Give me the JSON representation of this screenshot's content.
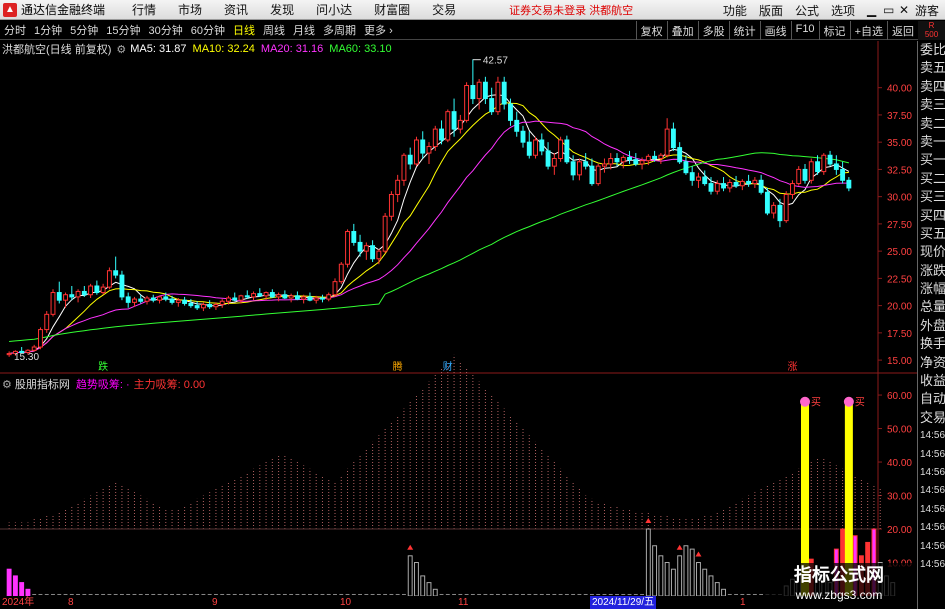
{
  "app": {
    "title": "通达信金融终端",
    "menus": [
      "行情",
      "市场",
      "资讯",
      "发现",
      "问小达",
      "财富圈",
      "交易"
    ],
    "notice": "证券交易未登录  洪都航空",
    "right_menus": [
      "功能",
      "版面",
      "公式",
      "选项"
    ],
    "window_buttons": [
      "▁",
      "▭",
      "✕"
    ],
    "guest": "游客"
  },
  "period_bar": {
    "tabs": [
      "分时",
      "1分钟",
      "5分钟",
      "15分钟",
      "30分钟",
      "60分钟",
      "日线",
      "周线",
      "月线",
      "多周期",
      "更多"
    ],
    "active": "日线",
    "more_arrow": "›",
    "tools": [
      "复权",
      "叠加",
      "多股",
      "统计",
      "画线",
      "F10",
      "标记",
      "+自选",
      "返回"
    ],
    "corner_tag": "R\n500"
  },
  "info": {
    "stock": "洪都航空(日线 前复权)",
    "ma": [
      {
        "label": "MA5: 31.87",
        "color": "#ffffff"
      },
      {
        "label": "MA10: 32.24",
        "color": "#ffff00"
      },
      {
        "label": "MA20: 31.16",
        "color": "#ff33ff"
      },
      {
        "label": "MA60: 33.10",
        "color": "#33ff33"
      }
    ]
  },
  "indicator": {
    "name": "股朋指标网",
    "line1": "趋势吸筹: ·",
    "line2": "主力吸筹: 0.00",
    "buy_label": "买"
  },
  "right_panel": [
    "委比",
    "卖五",
    "卖四",
    "卖三",
    "卖二",
    "卖一",
    "买一",
    "买二",
    "买三",
    "买四",
    "买五",
    "现价",
    "涨跌",
    "涨幅",
    "总量",
    "外盘",
    "换手",
    "净资",
    "收益",
    "自动",
    "交易",
    "14:56",
    "14:56",
    "14:56",
    "14:56",
    "14:56",
    "14:56",
    "14:56",
    "14:56"
  ],
  "price_axis": {
    "ticks": [
      "40.00",
      "37.50",
      "35.00",
      "32.50",
      "30.00",
      "27.50",
      "25.00",
      "22.50",
      "20.00",
      "17.50",
      "15.00"
    ]
  },
  "indicator_axis": {
    "ticks": [
      "60.00",
      "50.00",
      "40.00",
      "30.00",
      "20.00",
      "10.00"
    ]
  },
  "annotations": {
    "high": "42.57",
    "low": "15.30",
    "markers": [
      "跌",
      "腾",
      "财",
      "涨"
    ]
  },
  "date_axis": {
    "labels": [
      "2024年",
      "8",
      "9",
      "10",
      "11",
      "1"
    ],
    "cursor": "2024/11/29/五"
  },
  "watermark": {
    "line1": "指标公式网",
    "line2": "www.zbgs3.com"
  },
  "colors": {
    "up": "#ff3333",
    "down": "#33ffff",
    "ma5": "#ffffff",
    "ma10": "#ffff00",
    "ma20": "#ff33ff",
    "ma60": "#33ff33",
    "grid": "#8b1a1a"
  },
  "chart_data": {
    "type": "candlestick",
    "ylim": [
      14,
      43
    ],
    "indicator_ylim": [
      0,
      63
    ],
    "candles": [
      [
        15.5,
        15.8,
        15.3,
        15.6
      ],
      [
        15.6,
        15.9,
        15.4,
        15.8
      ],
      [
        15.8,
        16.2,
        15.6,
        15.7
      ],
      [
        15.7,
        16.0,
        15.5,
        15.9
      ],
      [
        15.9,
        16.4,
        15.8,
        16.2
      ],
      [
        16.2,
        18.0,
        16.0,
        17.8
      ],
      [
        17.8,
        19.5,
        17.5,
        19.2
      ],
      [
        19.2,
        21.5,
        19.0,
        21.2
      ],
      [
        21.2,
        22.2,
        20.2,
        20.5
      ],
      [
        20.5,
        21.2,
        19.8,
        21.0
      ],
      [
        21.0,
        21.8,
        20.5,
        20.8
      ],
      [
        20.8,
        21.5,
        20.3,
        21.3
      ],
      [
        21.3,
        21.8,
        20.8,
        21.0
      ],
      [
        21.0,
        22.0,
        20.7,
        21.8
      ],
      [
        21.8,
        22.3,
        21.0,
        21.2
      ],
      [
        21.2,
        22.0,
        21.0,
        21.7
      ],
      [
        21.7,
        23.5,
        21.5,
        23.2
      ],
      [
        23.2,
        24.5,
        22.5,
        22.8
      ],
      [
        22.8,
        23.2,
        20.5,
        20.8
      ],
      [
        20.8,
        21.2,
        19.8,
        20.3
      ],
      [
        20.3,
        20.8,
        19.9,
        20.6
      ],
      [
        20.6,
        21.0,
        20.2,
        20.4
      ],
      [
        20.4,
        20.9,
        20.1,
        20.7
      ],
      [
        20.7,
        21.0,
        20.3,
        20.5
      ],
      [
        20.5,
        20.9,
        20.2,
        20.8
      ],
      [
        20.8,
        21.2,
        20.4,
        20.6
      ],
      [
        20.6,
        20.9,
        20.1,
        20.3
      ],
      [
        20.3,
        20.7,
        19.9,
        20.5
      ],
      [
        20.5,
        20.8,
        20.0,
        20.2
      ],
      [
        20.2,
        20.6,
        19.8,
        20.0
      ],
      [
        20.0,
        20.4,
        19.6,
        19.8
      ],
      [
        19.8,
        20.3,
        19.5,
        20.1
      ],
      [
        20.1,
        20.5,
        19.7,
        19.9
      ],
      [
        19.9,
        20.3,
        19.6,
        20.1
      ],
      [
        20.1,
        20.6,
        19.8,
        20.4
      ],
      [
        20.4,
        20.9,
        20.1,
        20.7
      ],
      [
        20.7,
        21.2,
        20.4,
        20.5
      ],
      [
        20.5,
        21.0,
        20.2,
        20.9
      ],
      [
        20.9,
        21.4,
        20.6,
        20.8
      ],
      [
        20.8,
        21.3,
        20.5,
        21.1
      ],
      [
        21.1,
        21.6,
        20.8,
        20.9
      ],
      [
        20.9,
        21.3,
        20.5,
        21.2
      ],
      [
        21.2,
        21.5,
        20.7,
        20.8
      ],
      [
        20.8,
        21.2,
        20.4,
        21.0
      ],
      [
        21.0,
        21.4,
        20.6,
        20.7
      ],
      [
        20.7,
        21.1,
        20.3,
        20.9
      ],
      [
        20.9,
        21.3,
        20.5,
        20.6
      ],
      [
        20.6,
        21.0,
        20.2,
        20.8
      ],
      [
        20.8,
        21.2,
        20.4,
        20.5
      ],
      [
        20.5,
        20.9,
        20.2,
        20.7
      ],
      [
        20.7,
        21.0,
        20.3,
        20.6
      ],
      [
        20.6,
        21.2,
        20.4,
        21.0
      ],
      [
        21.0,
        22.5,
        20.8,
        22.2
      ],
      [
        22.2,
        24.0,
        22.0,
        23.8
      ],
      [
        23.8,
        27.0,
        23.5,
        26.8
      ],
      [
        26.8,
        27.5,
        25.5,
        25.8
      ],
      [
        25.8,
        26.5,
        24.5,
        25.0
      ],
      [
        25.0,
        25.8,
        24.2,
        25.5
      ],
      [
        25.5,
        26.0,
        24.0,
        24.3
      ],
      [
        24.3,
        25.2,
        23.8,
        25.0
      ],
      [
        25.0,
        28.5,
        24.8,
        28.2
      ],
      [
        28.2,
        30.5,
        27.8,
        30.2
      ],
      [
        30.2,
        32.0,
        29.5,
        31.5
      ],
      [
        31.5,
        34.0,
        31.0,
        33.8
      ],
      [
        33.8,
        34.5,
        32.5,
        33.0
      ],
      [
        33.0,
        35.5,
        32.8,
        35.2
      ],
      [
        35.2,
        36.0,
        33.5,
        34.0
      ],
      [
        34.0,
        35.0,
        33.0,
        34.6
      ],
      [
        34.6,
        36.5,
        34.2,
        36.2
      ],
      [
        36.2,
        37.0,
        34.8,
        35.2
      ],
      [
        35.2,
        38.0,
        35.0,
        37.8
      ],
      [
        37.8,
        39.0,
        35.5,
        36.2
      ],
      [
        36.2,
        37.5,
        35.8,
        37.0
      ],
      [
        37.0,
        40.5,
        36.8,
        40.2
      ],
      [
        40.2,
        42.6,
        38.5,
        39.0
      ],
      [
        39.0,
        40.8,
        38.0,
        40.5
      ],
      [
        40.5,
        41.0,
        38.5,
        39.0
      ],
      [
        39.0,
        40.0,
        37.5,
        37.8
      ],
      [
        37.8,
        41.0,
        37.5,
        40.5
      ],
      [
        40.5,
        41.0,
        38.0,
        38.5
      ],
      [
        38.5,
        39.0,
        36.5,
        37.0
      ],
      [
        37.0,
        37.8,
        35.5,
        36.0
      ],
      [
        36.0,
        36.5,
        34.5,
        35.0
      ],
      [
        35.0,
        36.0,
        33.5,
        33.8
      ],
      [
        33.8,
        35.5,
        33.5,
        35.2
      ],
      [
        35.2,
        35.8,
        33.8,
        34.2
      ],
      [
        34.2,
        35.0,
        32.5,
        32.8
      ],
      [
        32.8,
        34.0,
        32.0,
        33.5
      ],
      [
        33.5,
        35.5,
        33.2,
        35.2
      ],
      [
        35.2,
        35.6,
        33.0,
        33.2
      ],
      [
        33.2,
        33.8,
        31.5,
        32.0
      ],
      [
        32.0,
        33.5,
        31.5,
        33.2
      ],
      [
        33.2,
        34.0,
        32.5,
        32.8
      ],
      [
        32.8,
        33.5,
        31.0,
        31.2
      ],
      [
        31.2,
        33.0,
        31.0,
        32.8
      ],
      [
        32.8,
        33.5,
        32.2,
        33.0
      ],
      [
        33.0,
        34.0,
        32.5,
        33.5
      ],
      [
        33.5,
        34.0,
        32.8,
        33.2
      ],
      [
        33.2,
        33.8,
        32.6,
        33.6
      ],
      [
        33.6,
        34.2,
        33.0,
        33.4
      ],
      [
        33.4,
        34.0,
        32.8,
        33.0
      ],
      [
        33.0,
        33.6,
        32.5,
        33.3
      ],
      [
        33.3,
        33.9,
        32.9,
        33.7
      ],
      [
        33.7,
        34.2,
        33.2,
        33.5
      ],
      [
        33.5,
        34.0,
        33.0,
        33.8
      ],
      [
        33.8,
        37.2,
        33.6,
        36.2
      ],
      [
        36.2,
        36.8,
        34.2,
        34.5
      ],
      [
        34.5,
        35.0,
        33.0,
        33.2
      ],
      [
        33.2,
        33.8,
        32.0,
        32.2
      ],
      [
        32.2,
        32.8,
        31.0,
        31.5
      ],
      [
        31.5,
        32.2,
        30.8,
        31.8
      ],
      [
        31.8,
        32.4,
        31.0,
        31.2
      ],
      [
        31.2,
        31.8,
        30.2,
        30.5
      ],
      [
        30.5,
        31.5,
        30.2,
        31.2
      ],
      [
        31.2,
        31.8,
        30.5,
        30.8
      ],
      [
        30.8,
        31.6,
        30.4,
        31.3
      ],
      [
        31.3,
        31.9,
        30.8,
        31.0
      ],
      [
        31.0,
        31.6,
        30.6,
        31.4
      ],
      [
        31.4,
        32.0,
        30.9,
        31.2
      ],
      [
        31.2,
        31.8,
        30.8,
        31.5
      ],
      [
        31.5,
        32.0,
        30.2,
        30.4
      ],
      [
        30.4,
        30.8,
        28.3,
        28.5
      ],
      [
        28.5,
        29.5,
        28.0,
        29.2
      ],
      [
        29.2,
        29.8,
        27.2,
        27.8
      ],
      [
        27.8,
        30.5,
        27.6,
        30.2
      ],
      [
        30.2,
        31.5,
        29.8,
        31.2
      ],
      [
        31.2,
        32.8,
        31.0,
        32.5
      ],
      [
        32.5,
        33.0,
        31.2,
        31.5
      ],
      [
        31.5,
        33.5,
        31.2,
        33.2
      ],
      [
        33.2,
        33.8,
        32.0,
        32.3
      ],
      [
        32.3,
        34.0,
        32.0,
        33.8
      ],
      [
        33.8,
        34.2,
        32.8,
        33.0
      ],
      [
        33.0,
        33.8,
        32.0,
        32.5
      ],
      [
        32.5,
        33.2,
        31.2,
        31.5
      ],
      [
        31.5,
        31.8,
        30.5,
        30.8
      ]
    ],
    "volumes_bg": [
      2,
      2,
      2,
      2,
      3,
      3,
      4,
      4,
      5,
      6,
      7,
      8,
      9,
      10,
      11,
      12,
      13,
      14,
      13,
      12,
      11,
      10,
      9,
      8,
      7,
      6,
      6,
      6,
      7,
      8,
      9,
      10,
      11,
      12,
      13,
      14,
      15,
      16,
      17,
      18,
      19,
      20,
      21,
      22,
      22,
      21,
      20,
      19,
      18,
      17,
      16,
      15,
      14,
      16,
      18,
      20,
      22,
      24,
      26,
      28,
      30,
      32,
      34,
      36,
      38,
      40,
      42,
      44,
      46,
      48,
      50,
      52,
      50,
      48,
      46,
      44,
      42,
      40,
      38,
      36,
      34,
      32,
      30,
      28,
      26,
      24,
      22,
      20,
      18,
      16,
      14,
      12,
      10,
      9,
      8,
      8,
      7,
      7,
      6,
      6,
      5,
      5,
      5,
      4,
      4,
      4,
      3,
      3,
      3,
      3,
      3,
      4,
      4,
      5,
      6,
      7,
      8,
      9,
      10,
      11,
      12,
      13,
      14,
      15,
      16,
      17,
      18,
      19,
      20,
      21,
      21,
      20,
      19,
      18,
      17,
      16,
      15,
      14,
      13,
      12
    ],
    "volumes_fg": [
      8,
      6,
      4,
      2,
      1,
      1,
      1,
      1,
      1,
      1,
      1,
      1,
      1,
      1,
      1,
      1,
      1,
      1,
      1,
      1,
      1,
      1,
      1,
      1,
      1,
      1,
      1,
      1,
      1,
      1,
      1,
      1,
      1,
      1,
      1,
      1,
      1,
      1,
      1,
      1,
      1,
      1,
      1,
      1,
      1,
      1,
      1,
      1,
      1,
      1,
      1,
      1,
      1,
      1,
      1,
      1,
      1,
      1,
      1,
      1,
      1,
      1,
      1,
      1,
      12,
      10,
      6,
      4,
      2,
      1,
      1,
      1,
      1,
      1,
      1,
      1,
      1,
      1,
      1,
      1,
      1,
      1,
      1,
      1,
      1,
      1,
      1,
      1,
      1,
      1,
      1,
      1,
      1,
      1,
      1,
      1,
      1,
      1,
      1,
      1,
      1,
      1,
      20,
      15,
      12,
      10,
      8,
      12,
      15,
      14,
      10,
      8,
      6,
      4,
      2,
      1,
      1,
      1,
      1,
      1,
      1,
      1,
      1,
      1,
      3,
      5,
      7,
      9,
      11,
      8,
      6,
      4,
      14,
      20,
      25,
      18,
      12,
      16,
      20,
      10,
      6,
      4
    ]
  }
}
